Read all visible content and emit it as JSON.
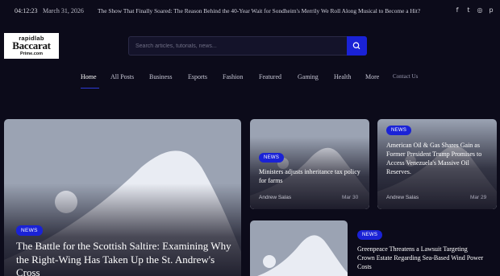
{
  "topbar": {
    "time": "04:12:23",
    "date": "March 31, 2026",
    "ticker": "The Show That Finally Soared: The Reason Behind the 40-Year Wait for Sondheim's Merrily We Roll Along Musical to Become a Hit?",
    "social": [
      {
        "icon": "facebook-icon",
        "glyph": "f"
      },
      {
        "icon": "twitter-icon",
        "glyph": "t"
      },
      {
        "icon": "instagram-icon",
        "glyph": "◎"
      },
      {
        "icon": "pinterest-icon",
        "glyph": "p"
      }
    ]
  },
  "logo": {
    "line1": "rapidlab",
    "line2": "Baccarat",
    "line3": "Prime.com"
  },
  "search": {
    "placeholder": "Search articles, tutorials, news..."
  },
  "nav": {
    "items": [
      "Home",
      "All Posts",
      "Business",
      "Esports",
      "Fashion",
      "Featured",
      "Gaming",
      "Health",
      "More",
      "Contact Us"
    ],
    "active": "Home"
  },
  "cards": {
    "main": {
      "badge": "NEWS",
      "title": "The Battle for the Scottish Saltire: Examining Why the Right-Wing Has Taken Up the St. Andrew's Cross"
    },
    "mid": {
      "badge": "NEWS",
      "title": "Ministers adjusts inheritance tax policy for farms",
      "author": "Andrew Salas",
      "date": "Mar 30"
    },
    "right": {
      "badge": "NEWS",
      "title": "American Oil & Gas Shares Gain as Former President Trump Promises to Access Venezuela's Massive Oil Reserves.",
      "author": "Andrew Salas",
      "date": "Mar 29"
    },
    "bottom": {
      "badge": "NEWS",
      "title": "Greenpeace Threatens a Lawsuit Targeting Crown Estate Regarding Sea-Based Wind Power Costs"
    }
  },
  "colors": {
    "background": "#0c0b1a",
    "accent": "#1a22d6",
    "placeholder_image": "#9ba3b3"
  }
}
